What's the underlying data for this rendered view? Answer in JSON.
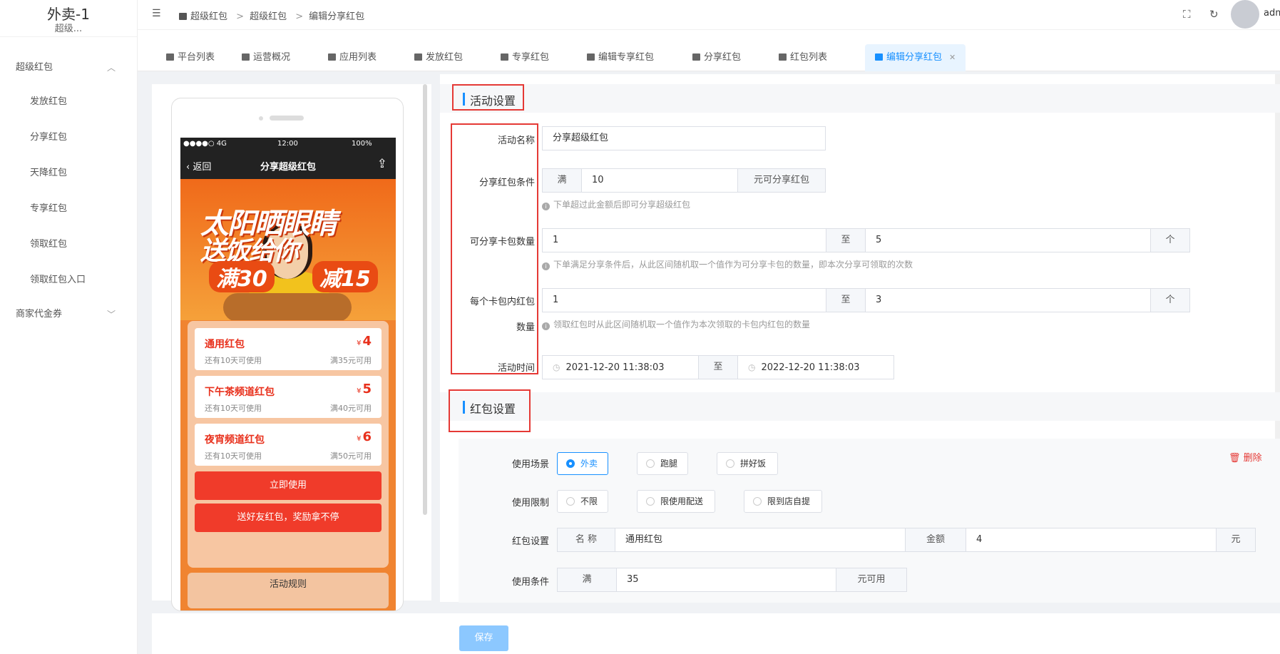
{
  "sidebar": {
    "app_title": "外卖-1",
    "app_subtitle": "超级...",
    "groups": [
      {
        "label": "超级红包",
        "expanded": true,
        "items": [
          "发放红包",
          "分享红包",
          "天降红包",
          "专享红包",
          "领取红包",
          "领取红包入口"
        ]
      },
      {
        "label": "商家代金券",
        "expanded": false
      }
    ]
  },
  "header": {
    "breadcrumb": [
      "超级红包",
      "超级红包",
      "编辑分享红包"
    ],
    "user": "adm"
  },
  "tabs": [
    {
      "label": "平台列表"
    },
    {
      "label": "运营概况"
    },
    {
      "label": "应用列表"
    },
    {
      "label": "发放红包"
    },
    {
      "label": "专享红包"
    },
    {
      "label": "编辑专享红包"
    },
    {
      "label": "分享红包"
    },
    {
      "label": "红包列表"
    },
    {
      "label": "编辑分享红包",
      "active": true
    }
  ],
  "phone": {
    "carrier": "●●●●○ 4G",
    "time": "12:00",
    "battery": "100%",
    "back": "返回",
    "title": "分享超级红包",
    "banner": {
      "line1": "太阳晒眼睛",
      "line2": "送饭给你",
      "tag1": "满30",
      "tag2": "减15"
    },
    "coupons": [
      {
        "name": "通用红包",
        "currency": "¥",
        "amount": "4",
        "desc": "还有10天可使用",
        "cond": "满35元可用"
      },
      {
        "name": "下午茶频道红包",
        "currency": "¥",
        "amount": "5",
        "desc": "还有10天可使用",
        "cond": "满40元可用"
      },
      {
        "name": "夜宵频道红包",
        "currency": "¥",
        "amount": "6",
        "desc": "还有10天可使用",
        "cond": "满50元可用"
      }
    ],
    "btn_use": "立即使用",
    "btn_share": "送好友红包，奖励拿不停",
    "rules": "活动规则"
  },
  "activity": {
    "section": "活动设置",
    "name_label": "活动名称",
    "name_value": "分享超级红包",
    "cond_label": "分享红包条件",
    "cond_prefix": "满",
    "cond_value": "10",
    "cond_suffix": "元可分享红包",
    "cond_hint": "下单超过此金额后即可分享超级红包",
    "count_label": "可分享卡包数量",
    "count_min": "1",
    "to": "至",
    "count_max": "5",
    "unit": "个",
    "count_hint": "下单满足分享条件后，从此区间随机取一个值作为可分享卡包的数量，即本次分享可领取的次数",
    "per_label_1": "每个卡包内红包",
    "per_label_2": "数量",
    "per_min": "1",
    "per_max": "3",
    "per_hint": "领取红包时从此区间随机取一个值作为本次领取的卡包内红包的数量",
    "time_label": "活动时间",
    "time_start": "2021-12-20 11:38:03",
    "time_end": "2022-12-20 11:38:03"
  },
  "redpacket": {
    "section": "红包设置",
    "delete": "删除",
    "scene_label": "使用场景",
    "scenes": [
      {
        "label": "外卖",
        "on": true
      },
      {
        "label": "跑腿",
        "on": false
      },
      {
        "label": "拼好饭",
        "on": false
      }
    ],
    "limit_label": "使用限制",
    "limits": [
      {
        "label": "不限",
        "on": false
      },
      {
        "label": "限使用配送",
        "on": false
      },
      {
        "label": "限到店自提",
        "on": false
      }
    ],
    "setting_label": "红包设置",
    "name_addon": "名 称",
    "name_value": "通用红包",
    "amount_addon": "金额",
    "amount_value": "4",
    "amount_unit": "元",
    "use_label": "使用条件",
    "use_prefix": "满",
    "use_value": "35",
    "use_suffix": "元可用"
  },
  "footer": {
    "save": "保存"
  }
}
